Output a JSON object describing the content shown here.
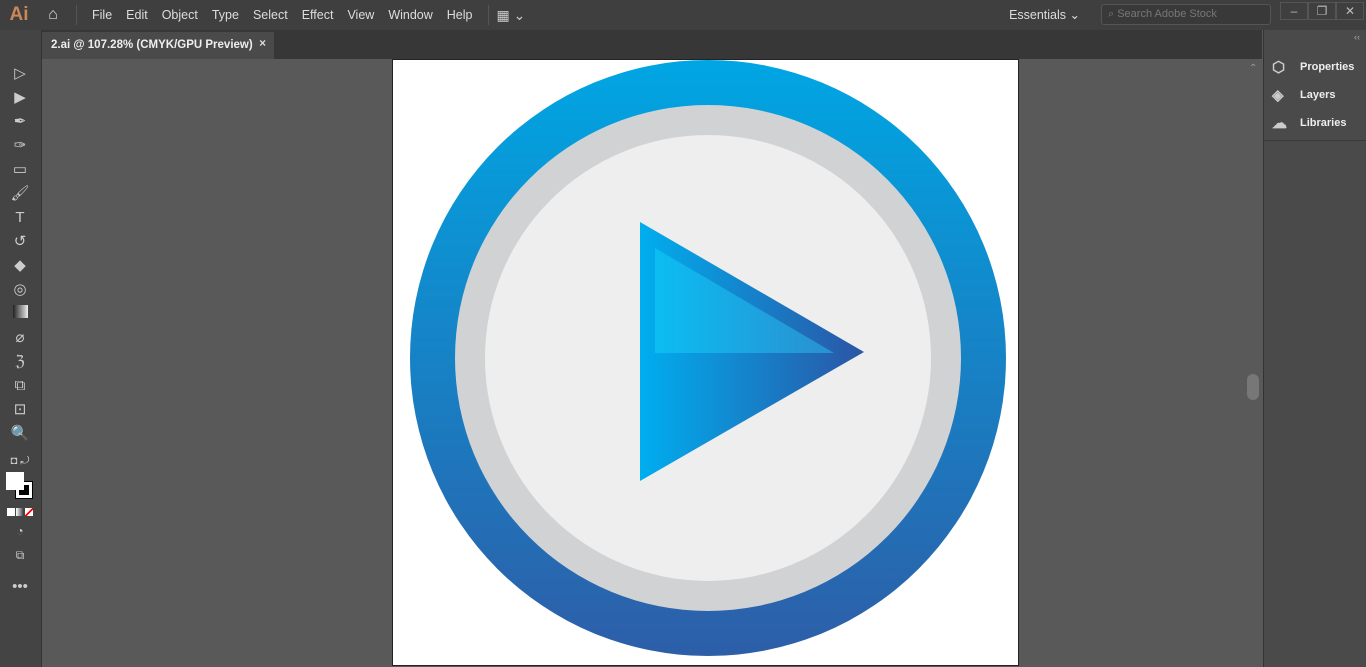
{
  "app": {
    "logo": "Ai",
    "menu": [
      "File",
      "Edit",
      "Object",
      "Type",
      "Select",
      "Effect",
      "View",
      "Window",
      "Help"
    ],
    "workspace": "Essentials",
    "search_placeholder": "Search Adobe Stock"
  },
  "document": {
    "tab_title": "2.ai @ 107.28% (CMYK/GPU Preview)",
    "close": "×"
  },
  "panels": [
    "Properties",
    "Layers",
    "Libraries"
  ],
  "tools": [
    "selection-tool",
    "direct-selection-tool",
    "pen-tool",
    "curvature-tool",
    "rectangle-tool",
    "paintbrush-tool",
    "type-tool",
    "rotate-tool",
    "eraser-tool",
    "shape-builder-tool",
    "gradient-tool",
    "eyedropper-tool",
    "puppet-warp-tool",
    "blend-tool",
    "artboard-tool",
    "zoom-tool"
  ],
  "colors": {
    "outer_top": "#00a6e3",
    "outer_bottom": "#2d5ea8",
    "ring": "#d1d2d4",
    "inner": "#eeeeef",
    "tri_a": "#00aeef",
    "tri_b": "#2b55a5"
  }
}
